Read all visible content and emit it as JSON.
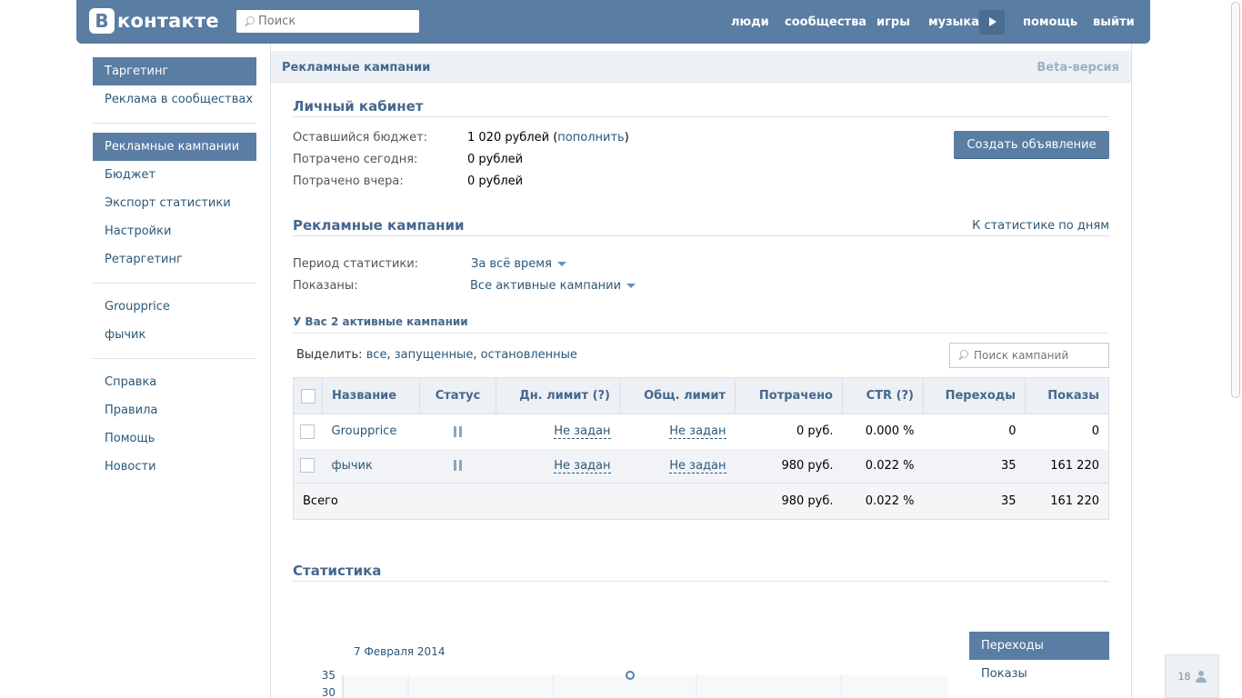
{
  "header": {
    "logo_letter": "B",
    "logo_text": "контакте",
    "search_placeholder": "Поиск",
    "nav": {
      "people": "люди",
      "communities": "сообщества",
      "games": "игры",
      "music": "музыка",
      "help": "помощь",
      "logout": "выйти"
    }
  },
  "sidebar": {
    "group1": [
      "Таргетинг",
      "Реклама в сообществах"
    ],
    "group2": [
      "Рекламные кампании",
      "Бюджет",
      "Экспорт статистики",
      "Настройки",
      "Ретаргетинг"
    ],
    "group3": [
      "Groupprice",
      "фычик"
    ],
    "group4": [
      "Справка",
      "Правила",
      "Помощь",
      "Новости"
    ]
  },
  "page": {
    "breadcrumb": "Рекламные кампании",
    "beta": "Beta-версия"
  },
  "cabinet": {
    "title": "Личный кабинет",
    "remaining_label": "Оставшийся бюджет:",
    "remaining_value": "1 020 рублей (",
    "topup_link": "пополнить",
    "remaining_close": ")",
    "today_label": "Потрачено сегодня:",
    "today_value": "0 рублей",
    "yesterday_label": "Потрачено вчера:",
    "yesterday_value": "0 рублей",
    "create_button": "Создать объявление"
  },
  "campaigns": {
    "title": "Рекламные кампании",
    "stats_by_day": "К статистике по дням",
    "period_label": "Период статистики:",
    "period_value": "За всё время",
    "shown_label": "Показаны:",
    "shown_value": "Все активные кампании",
    "active_count": "У Вас 2 активные кампании",
    "select_label": "Выделить:",
    "select_all": "все",
    "select_running": "запущенные",
    "select_stopped": "остановленные",
    "search_placeholder": "Поиск кампаний"
  },
  "table": {
    "headers": [
      "Название",
      "Статус",
      "Дн. лимит (?)",
      "Общ. лимит",
      "Потрачено",
      "CTR (?)",
      "Переходы",
      "Показы"
    ],
    "rows": [
      {
        "name": "Groupprice",
        "day_limit": "Не задан",
        "total_limit": "Не задан",
        "spent": "0 руб.",
        "ctr": "0.000 %",
        "clicks": "0",
        "views": "0"
      },
      {
        "name": "фычик",
        "day_limit": "Не задан",
        "total_limit": "Не задан",
        "spent": "980 руб.",
        "ctr": "0.022 %",
        "clicks": "35",
        "views": "161 220"
      }
    ],
    "total": {
      "label": "Всего",
      "spent": "980 руб.",
      "ctr": "0.022 %",
      "clicks": "35",
      "views": "161 220"
    }
  },
  "stats": {
    "title": "Статистика",
    "tooltip_date": "7 Февраля 2014",
    "legend": [
      "Переходы",
      "Показы"
    ]
  },
  "chart_data": {
    "type": "line",
    "series": [
      {
        "name": "Переходы",
        "points": [
          {
            "x": "7 Февраля 2014",
            "y": 35
          }
        ]
      }
    ],
    "ytick_labels": [
      "35",
      "30"
    ]
  },
  "counter": {
    "value": "18"
  }
}
